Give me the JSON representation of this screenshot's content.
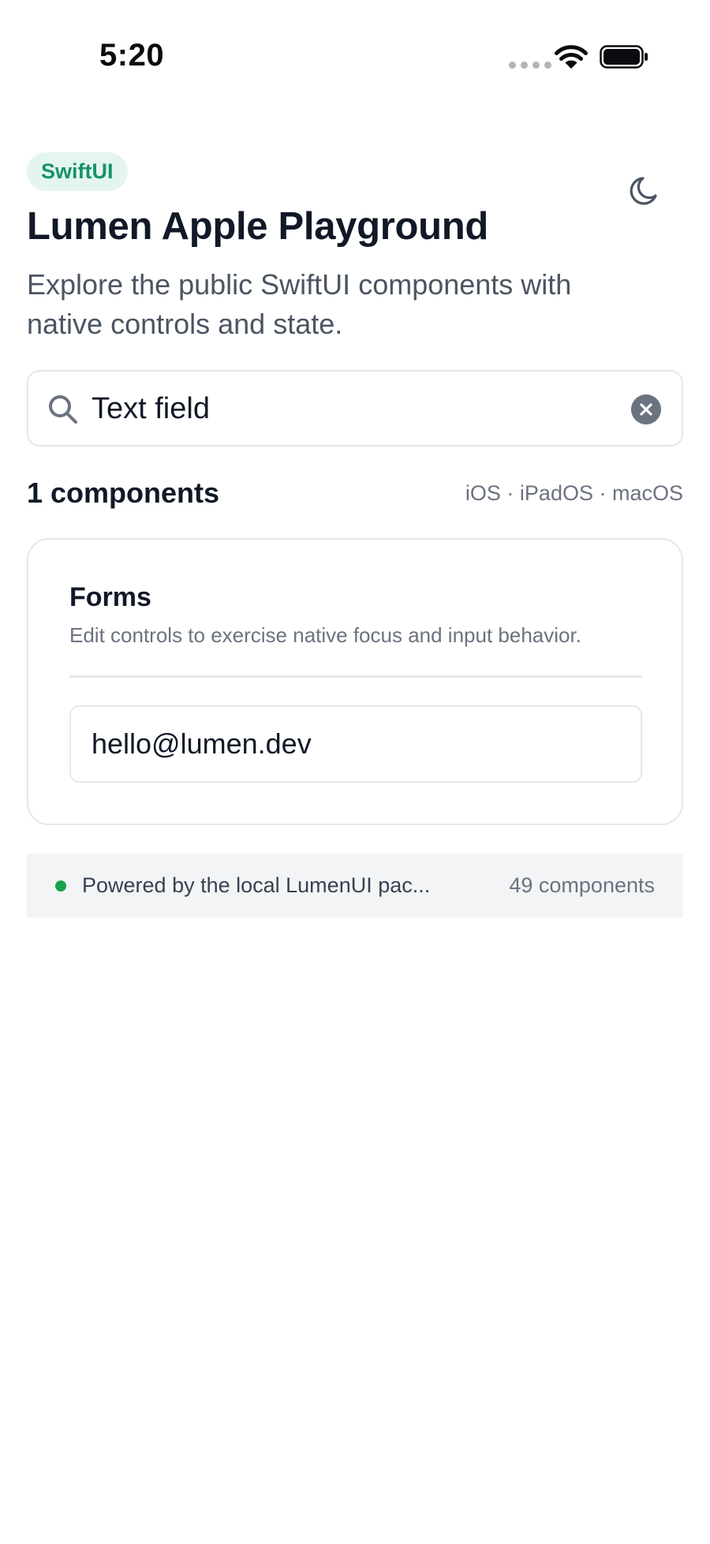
{
  "status_bar": {
    "time": "5:20"
  },
  "header": {
    "badge": "SwiftUI",
    "title": "Lumen Apple Playground",
    "subtitle": "Explore the public SwiftUI components with native controls and state."
  },
  "search": {
    "value": "Text field"
  },
  "results": {
    "count_label": "1 components",
    "platforms": "iOS · iPadOS · macOS"
  },
  "card": {
    "title": "Forms",
    "description": "Edit controls to exercise native focus and input behavior.",
    "field_value": "hello@lumen.dev"
  },
  "footer": {
    "status_text": "Powered by the local LumenUI pac...",
    "component_count": "49 components"
  },
  "colors": {
    "accent": "#16926b",
    "status_dot": "#16a34a",
    "badge_bg": "#e4f5ee"
  },
  "icons": [
    "wifi-icon",
    "battery-icon",
    "moon-icon",
    "search-icon",
    "clear-icon"
  ]
}
